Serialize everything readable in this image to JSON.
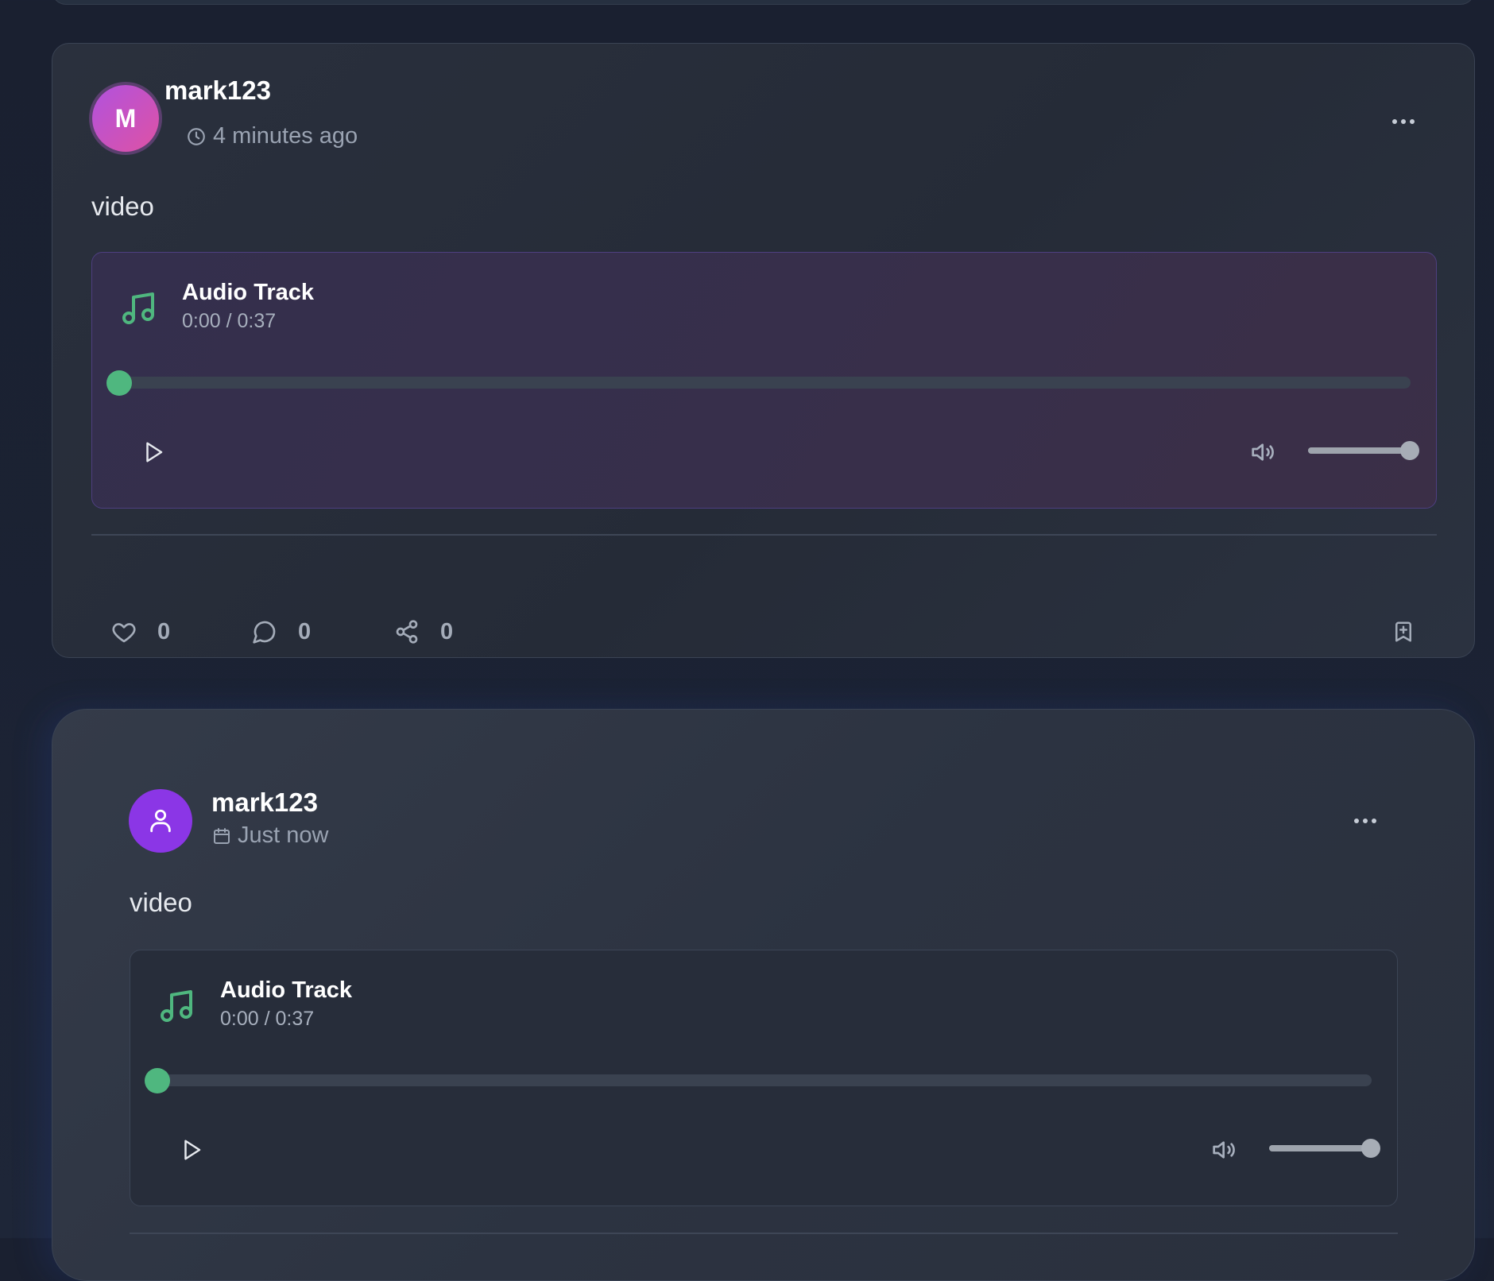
{
  "posts": [
    {
      "avatar_initial": "M",
      "username": "mark123",
      "timestamp": "4 minutes ago",
      "timestamp_icon": "clock-icon",
      "text": "video",
      "audio": {
        "title": "Audio Track",
        "time": "0:00 / 0:37",
        "progress": 0,
        "volume": 1
      },
      "actions": {
        "likes": "0",
        "comments": "0",
        "shares": "0"
      }
    },
    {
      "avatar_icon": "user-icon",
      "username": "mark123",
      "timestamp": "Just now",
      "timestamp_icon": "calendar-icon",
      "text": "video",
      "audio": {
        "title": "Audio Track",
        "time": "0:00 / 0:37",
        "progress": 0,
        "volume": 1
      }
    }
  ],
  "colors": {
    "accent_green": "#4fb77f",
    "avatar_gradient_start": "#b152de",
    "avatar_gradient_end": "#de52a4",
    "avatar_purple": "#8b36e6",
    "background": "#1b2233"
  }
}
